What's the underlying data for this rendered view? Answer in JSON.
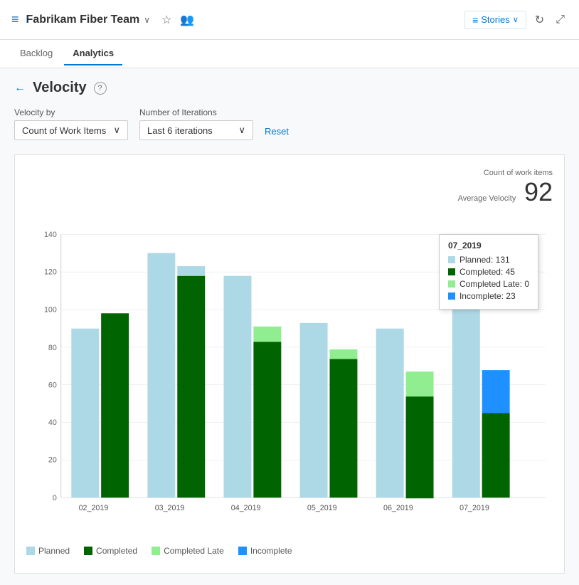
{
  "header": {
    "icon": "≡",
    "title": "Fabrikam Fiber Team",
    "chevron": "∨",
    "star_icon": "☆",
    "people_icon": "👥",
    "stories_label": "Stories",
    "stories_chevron": "∨",
    "refresh_icon": "↻",
    "expand_icon": "⤢"
  },
  "nav": {
    "tabs": [
      {
        "id": "backlog",
        "label": "Backlog",
        "active": false
      },
      {
        "id": "analytics",
        "label": "Analytics",
        "active": true
      }
    ]
  },
  "page": {
    "back_label": "←",
    "title": "Velocity",
    "help_label": "?",
    "velocity_by_label": "Velocity by",
    "iterations_label": "Number of Iterations",
    "velocity_by_value": "Count of Work Items",
    "iterations_value": "Last 6 iterations",
    "reset_label": "Reset",
    "count_label": "Count of work items",
    "avg_velocity_label": "Average Velocity",
    "avg_velocity_value": "92"
  },
  "tooltip": {
    "title": "07_2019",
    "items": [
      {
        "color": "#add8e6",
        "label": "Planned: 131"
      },
      {
        "color": "#006400",
        "label": "Completed: 45"
      },
      {
        "color": "#90ee90",
        "label": "Completed Late: 0"
      },
      {
        "color": "#1e90ff",
        "label": "Incomplete: 23"
      }
    ]
  },
  "legend": [
    {
      "color": "#add8e6",
      "label": "Planned"
    },
    {
      "color": "#006400",
      "label": "Completed"
    },
    {
      "color": "#90ee90",
      "label": "Completed Late"
    },
    {
      "color": "#1e90ff",
      "label": "Incomplete"
    }
  ],
  "chart": {
    "bars": [
      {
        "label": "02_2019",
        "planned": 90,
        "completed": 98,
        "completed_late": 0,
        "incomplete": 0
      },
      {
        "label": "03_2019",
        "planned": 130,
        "completed": 118,
        "completed_late": 0,
        "incomplete": 0
      },
      {
        "label": "04_2019",
        "planned": 118,
        "completed": 83,
        "completed_late": 8,
        "incomplete": 0
      },
      {
        "label": "05_2019",
        "planned": 93,
        "completed": 74,
        "completed_late": 5,
        "incomplete": 0
      },
      {
        "label": "06_2019",
        "planned": 90,
        "completed": 54,
        "completed_late": 13,
        "incomplete": 0
      },
      {
        "label": "07_2019",
        "planned": 131,
        "completed": 45,
        "completed_late": 0,
        "incomplete": 23
      }
    ],
    "max_value": 140,
    "y_ticks": [
      0,
      20,
      40,
      60,
      80,
      100,
      120,
      140
    ]
  }
}
